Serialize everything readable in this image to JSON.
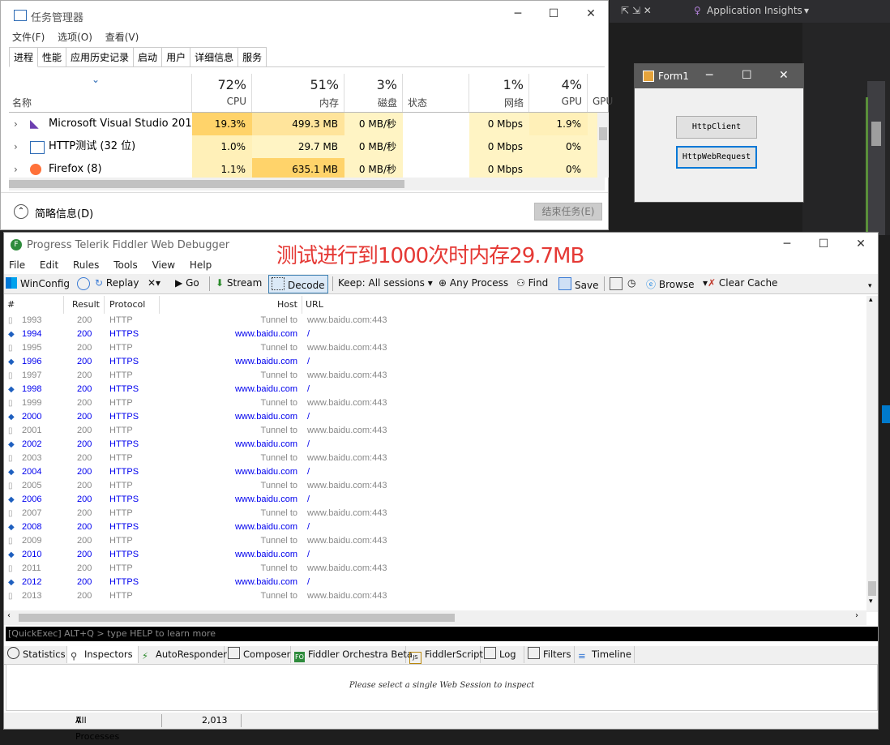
{
  "vs": {
    "app_insights": "Application Insights"
  },
  "task_manager": {
    "title": "任务管理器",
    "menu": [
      "文件(F)",
      "选项(O)",
      "查看(V)"
    ],
    "tabs": [
      "进程",
      "性能",
      "应用历史记录",
      "启动",
      "用户",
      "详细信息",
      "服务"
    ],
    "name_header": "名称",
    "status_header": "状态",
    "columns": [
      {
        "pct": "72%",
        "label": "CPU"
      },
      {
        "pct": "51%",
        "label": "内存"
      },
      {
        "pct": "3%",
        "label": "磁盘"
      },
      {
        "pct": "1%",
        "label": "网络"
      },
      {
        "pct": "4%",
        "label": "GPU"
      },
      {
        "pct": "",
        "label": "GPU"
      }
    ],
    "rows": [
      {
        "name": "Microsoft Visual Studio 201...",
        "cpu": "19.3%",
        "mem": "499.3 MB",
        "disk": "0 MB/秒",
        "net": "0 Mbps",
        "gpu": "1.9%"
      },
      {
        "name": "HTTP测试 (32 位)",
        "cpu": "1.0%",
        "mem": "29.7 MB",
        "disk": "0 MB/秒",
        "net": "0 Mbps",
        "gpu": "0%"
      },
      {
        "name": "Firefox (8)",
        "cpu": "1.1%",
        "mem": "635.1 MB",
        "disk": "0 MB/秒",
        "net": "0 Mbps",
        "gpu": "0%"
      }
    ],
    "fewer_details": "简略信息(D)",
    "end_task": "结束任务(E)"
  },
  "form1": {
    "title": "Form1",
    "btn1": "HttpClient",
    "btn2": "HttpWebRequest"
  },
  "fiddler": {
    "title": "Progress Telerik Fiddler Web Debugger",
    "annotation": "测试进行到1000次时内存29.7MB",
    "menu": [
      "File",
      "Edit",
      "Rules",
      "Tools",
      "View",
      "Help"
    ],
    "toolbar": {
      "winconfig": "WinConfig",
      "replay": "Replay",
      "go": "Go",
      "stream": "Stream",
      "decode": "Decode",
      "keep": "Keep: All sessions",
      "any_process": "Any Process",
      "find": "Find",
      "save": "Save",
      "browse": "Browse",
      "clear_cache": "Clear Cache"
    },
    "headers": {
      "num": "#",
      "result": "Result",
      "protocol": "Protocol",
      "host": "Host",
      "url": "URL"
    },
    "sessions": [
      {
        "num": "1993",
        "result": "200",
        "protocol": "HTTP",
        "host": "Tunnel to",
        "url": "www.baidu.com:443"
      },
      {
        "num": "1994",
        "result": "200",
        "protocol": "HTTPS",
        "host": "www.baidu.com",
        "url": "/"
      },
      {
        "num": "1995",
        "result": "200",
        "protocol": "HTTP",
        "host": "Tunnel to",
        "url": "www.baidu.com:443"
      },
      {
        "num": "1996",
        "result": "200",
        "protocol": "HTTPS",
        "host": "www.baidu.com",
        "url": "/"
      },
      {
        "num": "1997",
        "result": "200",
        "protocol": "HTTP",
        "host": "Tunnel to",
        "url": "www.baidu.com:443"
      },
      {
        "num": "1998",
        "result": "200",
        "protocol": "HTTPS",
        "host": "www.baidu.com",
        "url": "/"
      },
      {
        "num": "1999",
        "result": "200",
        "protocol": "HTTP",
        "host": "Tunnel to",
        "url": "www.baidu.com:443"
      },
      {
        "num": "2000",
        "result": "200",
        "protocol": "HTTPS",
        "host": "www.baidu.com",
        "url": "/"
      },
      {
        "num": "2001",
        "result": "200",
        "protocol": "HTTP",
        "host": "Tunnel to",
        "url": "www.baidu.com:443"
      },
      {
        "num": "2002",
        "result": "200",
        "protocol": "HTTPS",
        "host": "www.baidu.com",
        "url": "/"
      },
      {
        "num": "2003",
        "result": "200",
        "protocol": "HTTP",
        "host": "Tunnel to",
        "url": "www.baidu.com:443"
      },
      {
        "num": "2004",
        "result": "200",
        "protocol": "HTTPS",
        "host": "www.baidu.com",
        "url": "/"
      },
      {
        "num": "2005",
        "result": "200",
        "protocol": "HTTP",
        "host": "Tunnel to",
        "url": "www.baidu.com:443"
      },
      {
        "num": "2006",
        "result": "200",
        "protocol": "HTTPS",
        "host": "www.baidu.com",
        "url": "/"
      },
      {
        "num": "2007",
        "result": "200",
        "protocol": "HTTP",
        "host": "Tunnel to",
        "url": "www.baidu.com:443"
      },
      {
        "num": "2008",
        "result": "200",
        "protocol": "HTTPS",
        "host": "www.baidu.com",
        "url": "/"
      },
      {
        "num": "2009",
        "result": "200",
        "protocol": "HTTP",
        "host": "Tunnel to",
        "url": "www.baidu.com:443"
      },
      {
        "num": "2010",
        "result": "200",
        "protocol": "HTTPS",
        "host": "www.baidu.com",
        "url": "/"
      },
      {
        "num": "2011",
        "result": "200",
        "protocol": "HTTP",
        "host": "Tunnel to",
        "url": "www.baidu.com:443"
      },
      {
        "num": "2012",
        "result": "200",
        "protocol": "HTTPS",
        "host": "www.baidu.com",
        "url": "/"
      },
      {
        "num": "2013",
        "result": "200",
        "protocol": "HTTP",
        "host": "Tunnel to",
        "url": "www.baidu.com:443"
      }
    ],
    "quickexec": "[QuickExec] ALT+Q > type HELP to learn more",
    "tabs": [
      "Statistics",
      "Inspectors",
      "AutoResponder",
      "Composer",
      "Fiddler Orchestra Beta",
      "FiddlerScript",
      "Log",
      "Filters",
      "Timeline"
    ],
    "inspector_message": "Please select a single Web Session to inspect",
    "status": {
      "process": "All Processes",
      "count": "2,013"
    }
  }
}
